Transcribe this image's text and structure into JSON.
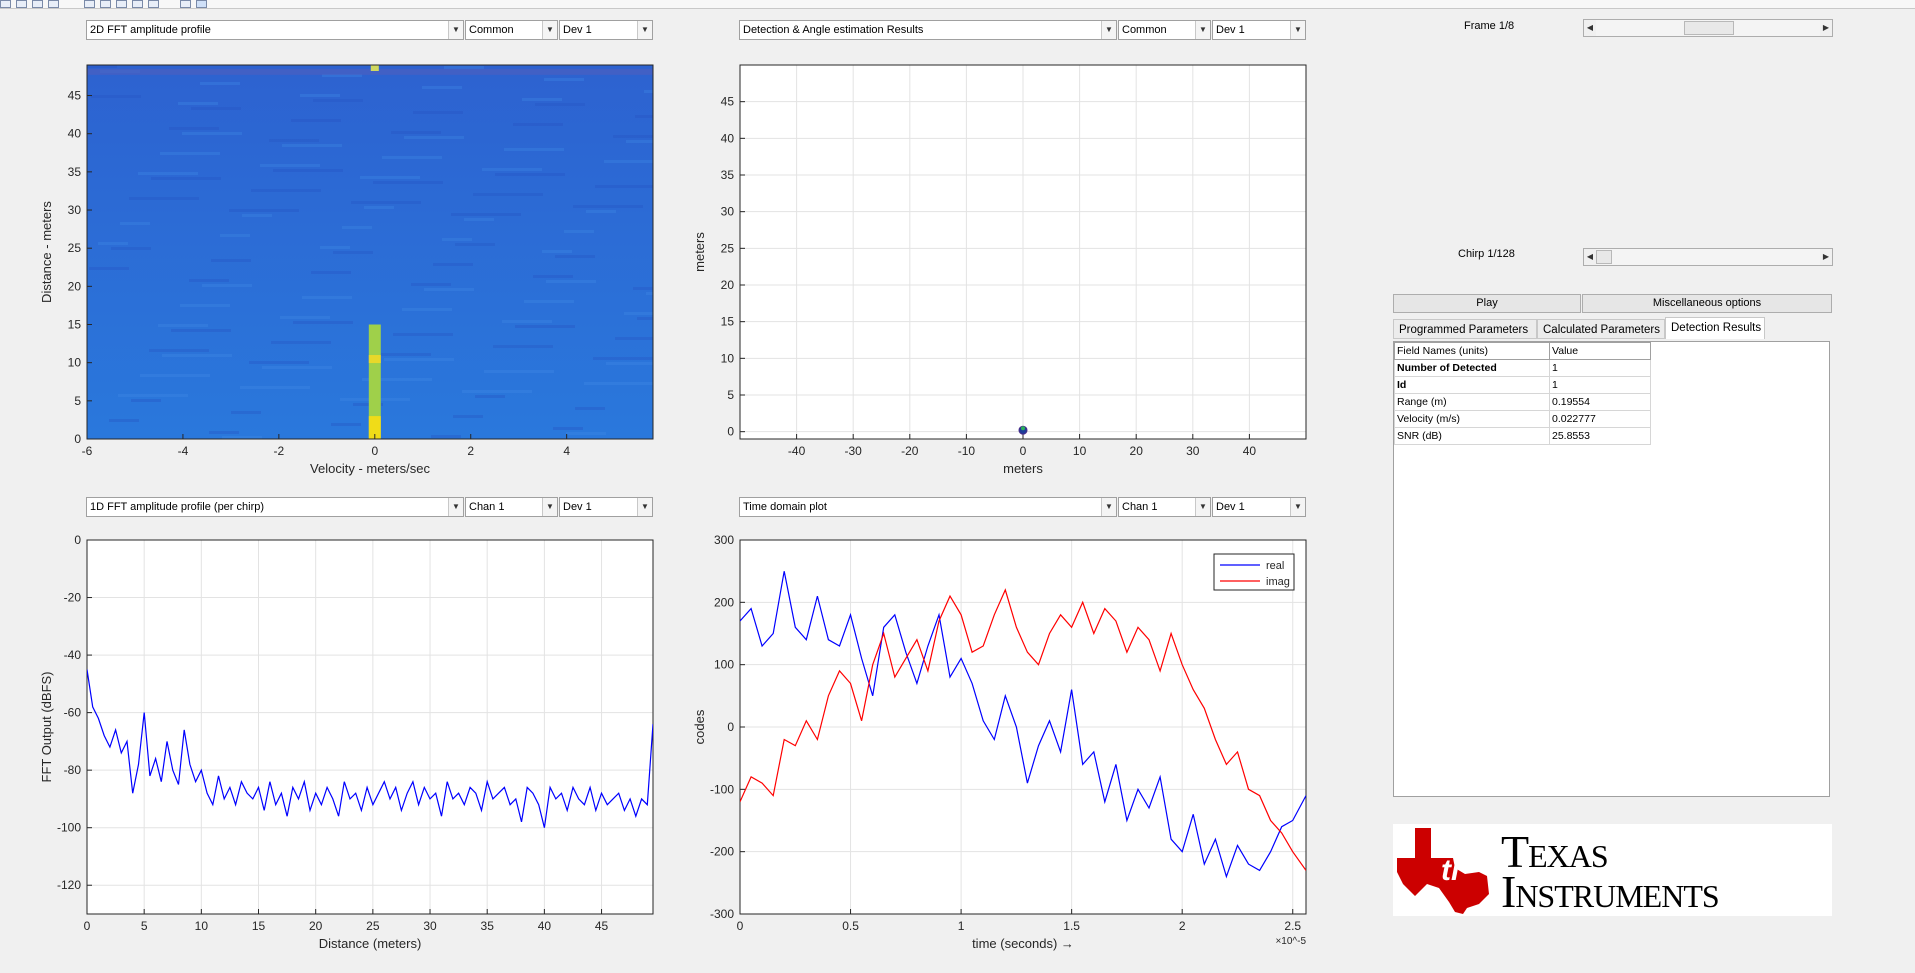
{
  "plots": {
    "top_left": {
      "view": "2D FFT amplitude profile",
      "channel": "Common",
      "device": "Dev 1"
    },
    "top_right": {
      "view": "Detection & Angle estimation Results",
      "channel": "Common",
      "device": "Dev 1"
    },
    "bottom_left": {
      "view": "1D FFT amplitude profile (per chirp)",
      "channel": "Chan 1",
      "device": "Dev 1"
    },
    "bottom_right": {
      "view": "Time domain plot",
      "channel": "Chan 1",
      "device": "Dev 1"
    }
  },
  "controls": {
    "frame_label": "Frame 1/8",
    "frame_position": 0.5,
    "chirp_label": "Chirp 1/128",
    "chirp_position": 0.0,
    "play_button": "Play",
    "misc_button": "Miscellaneous options"
  },
  "tabs": [
    "Programmed Parameters",
    "Calculated Parameters",
    "Detection Results"
  ],
  "active_tab": "Detection Results",
  "results": {
    "headers": [
      "Field Names    (units)",
      "Value"
    ],
    "rows": [
      {
        "name": "Number of Detected",
        "value": "1",
        "bold": true
      },
      {
        "name": "Id",
        "value": "1",
        "bold": true
      },
      {
        "name": "Range (m)",
        "value": "0.19554",
        "bold": false
      },
      {
        "name": "Velocity (m/s)",
        "value": "0.022777",
        "bold": false
      },
      {
        "name": "SNR (dB)",
        "value": "25.8553",
        "bold": false
      }
    ]
  },
  "logo": {
    "brand_line1": "Texas",
    "brand_line2": "Instruments",
    "color": "#cc0000"
  },
  "colors": {
    "blue": "#0000ff",
    "red": "#ff0000",
    "heat_bg": "#2a6fd6",
    "heat_hot": "#f0dc18"
  },
  "chart_data": [
    {
      "type": "heatmap",
      "title": "",
      "xlabel": "Velocity - meters/sec",
      "ylabel": "Distance - meters",
      "xlim": [
        -6,
        5.8
      ],
      "ylim": [
        0,
        49
      ],
      "xticks": [
        -6,
        -4,
        -2,
        0,
        2,
        4
      ],
      "yticks": [
        0,
        5,
        10,
        15,
        20,
        25,
        30,
        35,
        40,
        45
      ],
      "hotspot": {
        "x": 0,
        "y_from": 0,
        "y_to": 15
      },
      "grid": false
    },
    {
      "type": "scatter",
      "title": "",
      "xlabel": "meters",
      "ylabel": "meters",
      "xlim": [
        -50,
        50
      ],
      "ylim": [
        -1,
        50
      ],
      "xticks": [
        -40,
        -30,
        -20,
        -10,
        0,
        10,
        20,
        30,
        40
      ],
      "yticks": [
        0,
        5,
        10,
        15,
        20,
        25,
        30,
        35,
        40,
        45
      ],
      "points": [
        {
          "x": 0,
          "y": 0.2
        }
      ],
      "grid": true
    },
    {
      "type": "line",
      "title": "",
      "xlabel": "Distance (meters)",
      "ylabel": "FFT Output (dBFS)",
      "xlim": [
        0,
        49.5
      ],
      "ylim": [
        -130,
        0
      ],
      "xticks": [
        0,
        5,
        10,
        15,
        20,
        25,
        30,
        35,
        40,
        45
      ],
      "yticks": [
        0,
        -20,
        -40,
        -60,
        -80,
        -100,
        -120
      ],
      "series": [
        {
          "color": "#0000ff",
          "x": [
            0,
            0.5,
            1,
            1.5,
            2,
            2.5,
            3,
            3.5,
            4,
            4.5,
            5,
            5.5,
            6,
            6.5,
            7,
            7.5,
            8,
            8.5,
            9,
            9.5,
            10,
            10.5,
            11,
            11.5,
            12,
            12.5,
            13,
            13.5,
            14,
            14.5,
            15,
            15.5,
            16,
            16.5,
            17,
            17.5,
            18,
            18.5,
            19,
            19.5,
            20,
            20.5,
            21,
            21.5,
            22,
            22.5,
            23,
            23.5,
            24,
            24.5,
            25,
            25.5,
            26,
            26.5,
            27,
            27.5,
            28,
            28.5,
            29,
            29.5,
            30,
            30.5,
            31,
            31.5,
            32,
            32.5,
            33,
            33.5,
            34,
            34.5,
            35,
            35.5,
            36,
            36.5,
            37,
            37.5,
            38,
            38.5,
            39,
            39.5,
            40,
            40.5,
            41,
            41.5,
            42,
            42.5,
            43,
            43.5,
            44,
            44.5,
            45,
            45.5,
            46,
            46.5,
            47,
            47.5,
            48,
            48.5,
            49,
            49.5
          ],
          "y": [
            -45,
            -58,
            -62,
            -68,
            -72,
            -66,
            -74,
            -70,
            -88,
            -78,
            -60,
            -82,
            -76,
            -84,
            -70,
            -80,
            -85,
            -66,
            -78,
            -84,
            -80,
            -88,
            -92,
            -82,
            -90,
            -86,
            -92,
            -84,
            -88,
            -90,
            -86,
            -94,
            -84,
            -92,
            -88,
            -96,
            -86,
            -90,
            -84,
            -94,
            -88,
            -92,
            -86,
            -90,
            -96,
            -84,
            -90,
            -88,
            -94,
            -86,
            -92,
            -88,
            -84,
            -90,
            -86,
            -94,
            -88,
            -84,
            -92,
            -86,
            -90,
            -88,
            -96,
            -84,
            -90,
            -88,
            -92,
            -86,
            -88,
            -94,
            -84,
            -90,
            -88,
            -86,
            -92,
            -90,
            -98,
            -86,
            -88,
            -92,
            -100,
            -86,
            -90,
            -88,
            -94,
            -86,
            -90,
            -92,
            -86,
            -94,
            -88,
            -92,
            -90,
            -88,
            -94,
            -90,
            -96,
            -90,
            -92,
            -64
          ]
        }
      ],
      "grid": true
    },
    {
      "type": "line",
      "title": "",
      "xlabel": "time  (seconds) →",
      "ylabel": "codes",
      "x_exponent_label": "×10^-5",
      "xlim": [
        0,
        2.56
      ],
      "ylim": [
        -300,
        300
      ],
      "xticks": [
        0,
        0.5,
        1,
        1.5,
        2,
        2.5
      ],
      "yticks": [
        300,
        200,
        100,
        0,
        -100,
        -200,
        -300
      ],
      "legend": "top-right",
      "series": [
        {
          "name": "real",
          "color": "#0000ff",
          "x": [
            0,
            0.05,
            0.1,
            0.15,
            0.2,
            0.25,
            0.3,
            0.35,
            0.4,
            0.45,
            0.5,
            0.55,
            0.6,
            0.65,
            0.7,
            0.75,
            0.8,
            0.85,
            0.9,
            0.95,
            1,
            1.05,
            1.1,
            1.15,
            1.2,
            1.25,
            1.3,
            1.35,
            1.4,
            1.45,
            1.5,
            1.55,
            1.6,
            1.65,
            1.7,
            1.75,
            1.8,
            1.85,
            1.9,
            1.95,
            2,
            2.05,
            2.1,
            2.15,
            2.2,
            2.25,
            2.3,
            2.35,
            2.4,
            2.45,
            2.5,
            2.56
          ],
          "y": [
            170,
            190,
            130,
            150,
            250,
            160,
            140,
            210,
            140,
            130,
            180,
            110,
            50,
            160,
            180,
            120,
            70,
            130,
            180,
            80,
            110,
            70,
            10,
            -20,
            50,
            0,
            -90,
            -30,
            10,
            -40,
            60,
            -60,
            -40,
            -120,
            -60,
            -150,
            -100,
            -130,
            -80,
            -180,
            -200,
            -140,
            -220,
            -180,
            -240,
            -190,
            -220,
            -230,
            -200,
            -160,
            -150,
            -110
          ]
        },
        {
          "name": "imag",
          "color": "#ff0000",
          "x": [
            0,
            0.05,
            0.1,
            0.15,
            0.2,
            0.25,
            0.3,
            0.35,
            0.4,
            0.45,
            0.5,
            0.55,
            0.6,
            0.65,
            0.7,
            0.75,
            0.8,
            0.85,
            0.9,
            0.95,
            1,
            1.05,
            1.1,
            1.15,
            1.2,
            1.25,
            1.3,
            1.35,
            1.4,
            1.45,
            1.5,
            1.55,
            1.6,
            1.65,
            1.7,
            1.75,
            1.8,
            1.85,
            1.9,
            1.95,
            2,
            2.05,
            2.1,
            2.15,
            2.2,
            2.25,
            2.3,
            2.35,
            2.4,
            2.45,
            2.5,
            2.56
          ],
          "y": [
            -120,
            -80,
            -90,
            -110,
            -20,
            -30,
            10,
            -20,
            50,
            90,
            70,
            10,
            100,
            150,
            80,
            110,
            140,
            90,
            170,
            210,
            180,
            120,
            130,
            180,
            220,
            160,
            120,
            100,
            150,
            180,
            160,
            200,
            150,
            190,
            170,
            120,
            160,
            140,
            90,
            150,
            100,
            60,
            30,
            -20,
            -60,
            -40,
            -100,
            -110,
            -150,
            -170,
            -200,
            -230
          ]
        }
      ],
      "grid": true
    }
  ]
}
